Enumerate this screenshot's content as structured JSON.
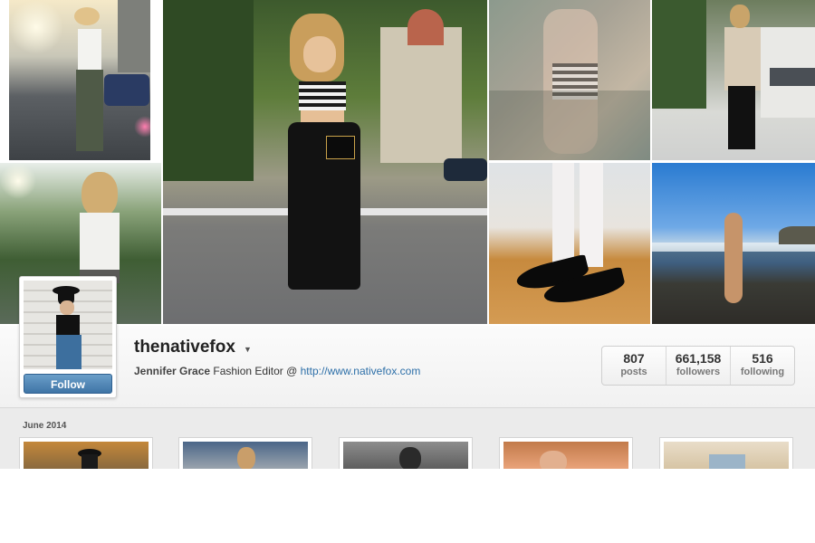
{
  "profile": {
    "username": "thenativefox",
    "bio_name": "Jennifer Grace",
    "bio_text": " Fashion Editor @ ",
    "bio_link": "http://www.nativefox.com",
    "follow_label": "Follow"
  },
  "stats": [
    {
      "value": "807",
      "label": "posts"
    },
    {
      "value": "661,158",
      "label": "followers"
    },
    {
      "value": "516",
      "label": "following"
    }
  ],
  "feed": {
    "month_label": "June 2014"
  },
  "icons": {
    "dropdown": "caret-down-icon"
  },
  "colors": {
    "follow_button": "#4f86b8",
    "link": "#2d6fa8"
  }
}
